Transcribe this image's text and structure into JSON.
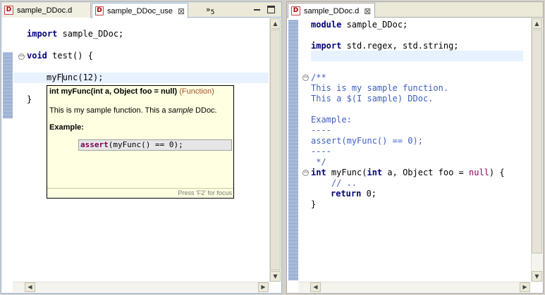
{
  "left_editor": {
    "tabs": [
      {
        "label": "sample_DDoc.d",
        "icon": "d-file-icon"
      },
      {
        "label": "sample_DDoc_use",
        "icon": "d-file-icon",
        "close": "⊠"
      }
    ],
    "overflow_symbol": "»",
    "overflow_count": "5",
    "code": {
      "l1_kw": "import",
      "l1_rest": " sample_DDoc;",
      "l2_kw": "void",
      "l2_rest": " test() {",
      "l3_a": "myF",
      "l3_b": "unc(12);",
      "l4": "}"
    }
  },
  "hover": {
    "signature": "int myFunc(int a, Object foo = null)",
    "kind": "(Function)",
    "desc_before": "This is my sample function. This a ",
    "desc_italic": "sample",
    "desc_after": " DDoc.",
    "example_heading": "Example:",
    "example_kw": "assert",
    "example_rest": "(myFunc() == 0);",
    "footer": "Press 'F2' for focus"
  },
  "right_editor": {
    "tab": {
      "label": "sample_DDoc.d",
      "icon": "d-file-icon",
      "close": "⊠"
    },
    "code": {
      "l1_kw": "module",
      "l1_rest": " sample_DDoc;",
      "l2_kw": "import",
      "l2_rest": " std.regex, std.string;",
      "c1": "/**",
      "c2": "This is my sample function.",
      "c3": "This a $(I sample) DDoc.",
      "c4": "Example:",
      "c5": "----",
      "c6": "assert(myFunc() == 0);",
      "c7": "----",
      "c8": " */",
      "f_kw": "int",
      "f_a": " myFunc(",
      "f_kw2": "int",
      "f_b": " a, Object foo = ",
      "f_null": "null",
      "f_c": ") {",
      "b1": "    // ..",
      "b2_kw": "return",
      "b2_rest": " 0;",
      "b3": "}"
    }
  }
}
